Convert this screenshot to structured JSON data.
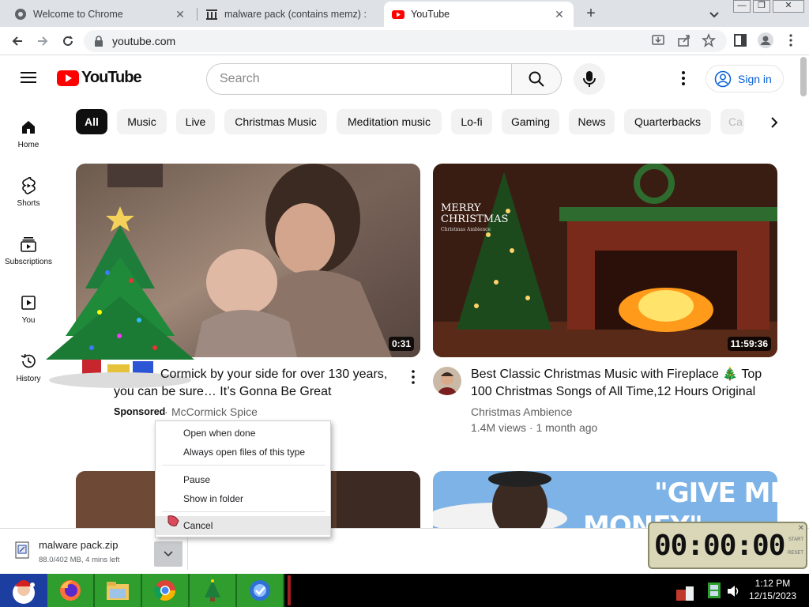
{
  "browser": {
    "tabs": [
      {
        "title": "Welcome to Chrome"
      },
      {
        "title": "malware pack (contains memz) :"
      },
      {
        "title": "YouTube"
      }
    ],
    "url": "youtube.com"
  },
  "youtube": {
    "logo_text": "YouTube",
    "search_placeholder": "Search",
    "signin_label": "Sign in",
    "left_nav": [
      {
        "label": "Home",
        "icon": "home-icon"
      },
      {
        "label": "Shorts",
        "icon": "shorts-icon"
      },
      {
        "label": "Subscriptions",
        "icon": "subscriptions-icon"
      },
      {
        "label": "You",
        "icon": "you-icon"
      },
      {
        "label": "History",
        "icon": "history-icon"
      }
    ],
    "chips": [
      "All",
      "Music",
      "Live",
      "Christmas Music",
      "Meditation music",
      "Lo-fi",
      "Gaming",
      "News",
      "Quarterbacks",
      "Ca"
    ],
    "videos": [
      {
        "title": "McCormick by your side for over 130 years, you can be sure… It’s Gonna Be Great",
        "title_visible_line1": "Cormick by your side for over 130 years,",
        "title_visible_line2": "you can be sure… It’s Gonna Be Great",
        "sponsored": "Sponsored",
        "channel": "McCormick Spice",
        "duration": "0:31"
      },
      {
        "title_line1": "Best Classic Christmas Music with Fireplace 🎄 Top",
        "title_line2": "100 Christmas Songs of All Time,12 Hours Original",
        "channel": "Christmas Ambience",
        "meta": "1.4M views · 1 month ago",
        "duration": "11:59:36",
        "thumb_text": "MERRY CHRISTMAS",
        "thumb_subtext": "Christmas Ambience"
      },
      {
        "thumb_text": "\"GIVE ME",
        "thumb_text2": "MONEY\""
      }
    ]
  },
  "context_menu": {
    "items": [
      "Open when done",
      "Always open files of this type",
      "Pause",
      "Show in folder",
      "Cancel"
    ]
  },
  "download": {
    "filename": "malware pack.zip",
    "status": "88.0/402 MB, 4 mins left"
  },
  "timer": {
    "display": "00:00:00",
    "start_label": "START",
    "reset_label": "RESET"
  },
  "taskbar": {
    "time": "1:12 PM",
    "date": "12/15/2023"
  },
  "colors": {
    "yt_red": "#ff0000",
    "link_blue": "#065fd4",
    "taskbar_green": "#2f9e2f"
  }
}
